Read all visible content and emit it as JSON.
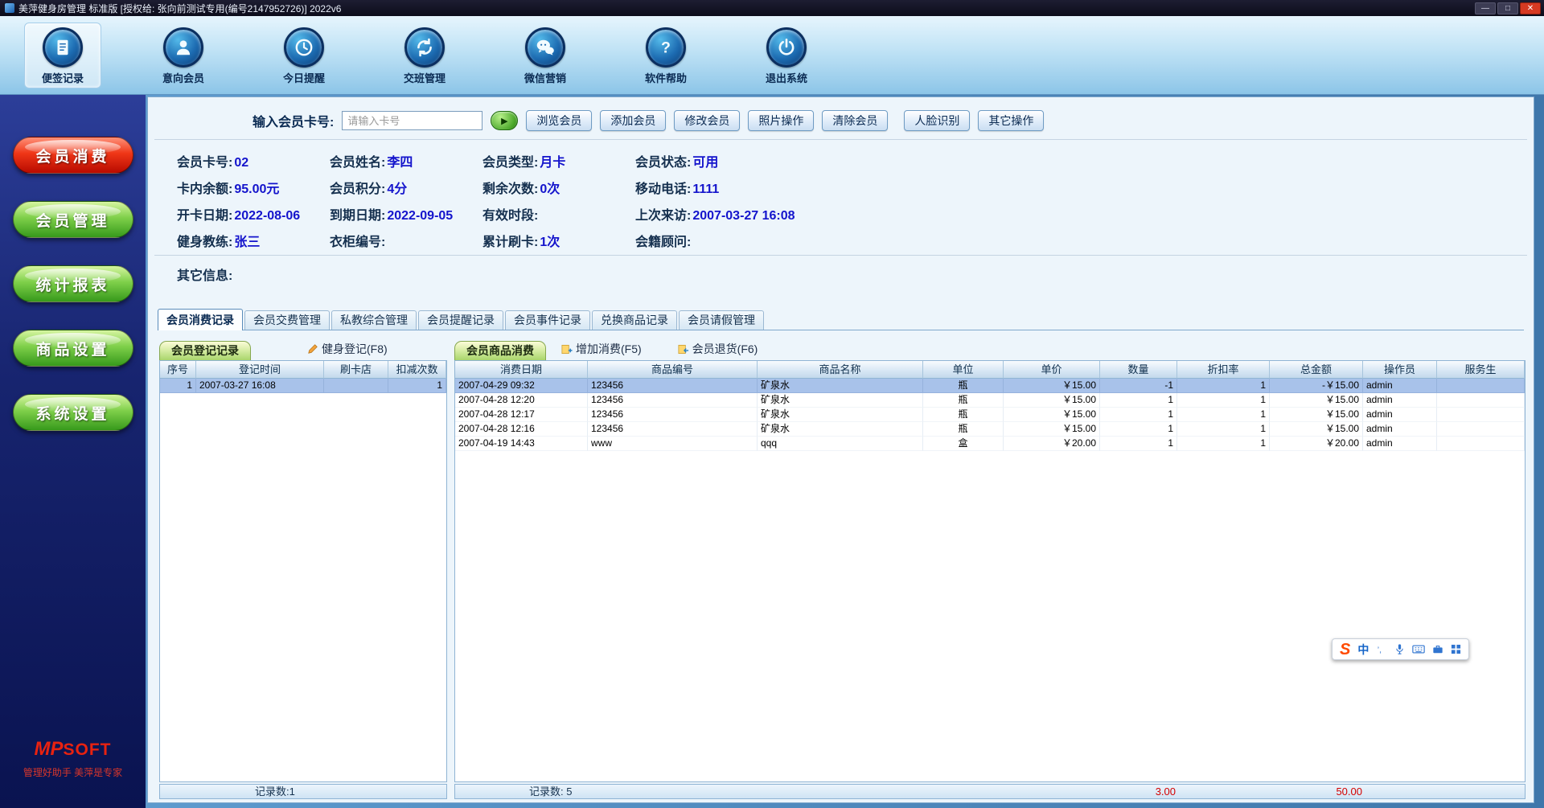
{
  "window": {
    "title": "美萍健身房管理 标准版 [授权给: 张向前测试专用(编号2147952726)]  2022v6",
    "controls": {
      "minimize": "—",
      "maximize": "□",
      "close": "✕"
    }
  },
  "toolbar": {
    "items": [
      {
        "label": "便签记录"
      },
      {
        "label": "意向会员"
      },
      {
        "label": "今日提醒"
      },
      {
        "label": "交班管理"
      },
      {
        "label": "微信营销"
      },
      {
        "label": "软件帮助"
      },
      {
        "label": "退出系统"
      }
    ]
  },
  "sidebar": {
    "items": [
      {
        "label": "会员消费"
      },
      {
        "label": "会员管理"
      },
      {
        "label": "统计报表"
      },
      {
        "label": "商品设置"
      },
      {
        "label": "系统设置"
      }
    ],
    "logo_mp": "MP",
    "logo_soft": "SOFT",
    "slogan": "管理好助手 美萍是专家"
  },
  "search": {
    "label": "输入会员卡号:",
    "placeholder": "请输入卡号",
    "go_button": "▶",
    "buttons": [
      "浏览会员",
      "添加会员",
      "修改会员",
      "照片操作",
      "清除会员",
      "人脸识别",
      "其它操作"
    ]
  },
  "member_info": {
    "fields": [
      {
        "label": "会员卡号:",
        "value": "02"
      },
      {
        "label": "会员姓名:",
        "value": "李四"
      },
      {
        "label": "会员类型:",
        "value": "月卡"
      },
      {
        "label": "会员状态:",
        "value": "可用"
      },
      {
        "label": "卡内余额:",
        "value": "95.00元"
      },
      {
        "label": "会员积分:",
        "value": "4分"
      },
      {
        "label": "剩余次数:",
        "value": "0次"
      },
      {
        "label": "移动电话:",
        "value": "1111"
      },
      {
        "label": "开卡日期:",
        "value": "2022-08-06"
      },
      {
        "label": "到期日期:",
        "value": "2022-09-05"
      },
      {
        "label": "有效时段:",
        "value": ""
      },
      {
        "label": "上次来访:",
        "value": "2007-03-27 16:08"
      },
      {
        "label": "健身教练:",
        "value": "张三"
      },
      {
        "label": "衣柜编号:",
        "value": ""
      },
      {
        "label": "累计刷卡:",
        "value": "1次"
      },
      {
        "label": "会籍顾问:",
        "value": ""
      }
    ],
    "other_info_label": "其它信息:"
  },
  "tabs": [
    "会员消费记录",
    "会员交费管理",
    "私教综合管理",
    "会员提醒记录",
    "会员事件记录",
    "兑换商品记录",
    "会员请假管理"
  ],
  "checkin_panel": {
    "tab": "会员登记记录",
    "button": "健身登记(F8)",
    "columns": [
      "序号",
      "登记时间",
      "刷卡店",
      "扣减次数"
    ],
    "rows": [
      [
        "1",
        "2007-03-27 16:08",
        "",
        "1"
      ]
    ],
    "footer": "记录数:1"
  },
  "consumption_panel": {
    "tab": "会员商品消费",
    "buttons": [
      "增加消费(F5)",
      "会员退货(F6)"
    ],
    "columns": [
      "消费日期",
      "商品编号",
      "商品名称",
      "单位",
      "单价",
      "数量",
      "折扣率",
      "总金额",
      "操作员",
      "服务生"
    ],
    "rows": [
      [
        "2007-04-29 09:32",
        "123456",
        "矿泉水",
        "瓶",
        "￥15.00",
        "-1",
        "1",
        "-￥15.00",
        "admin",
        ""
      ],
      [
        "2007-04-28 12:20",
        "123456",
        "矿泉水",
        "瓶",
        "￥15.00",
        "1",
        "1",
        "￥15.00",
        "admin",
        ""
      ],
      [
        "2007-04-28 12:17",
        "123456",
        "矿泉水",
        "瓶",
        "￥15.00",
        "1",
        "1",
        "￥15.00",
        "admin",
        ""
      ],
      [
        "2007-04-28 12:16",
        "123456",
        "矿泉水",
        "瓶",
        "￥15.00",
        "1",
        "1",
        "￥15.00",
        "admin",
        ""
      ],
      [
        "2007-04-19 14:43",
        "www",
        "qqq",
        "盒",
        "￥20.00",
        "1",
        "1",
        "￥20.00",
        "admin",
        ""
      ]
    ],
    "footer": {
      "count": "记录数: 5",
      "qty_total": "3.00",
      "amount_total": "50.00"
    }
  },
  "ime": {
    "logo": "S",
    "mode": "中"
  }
}
